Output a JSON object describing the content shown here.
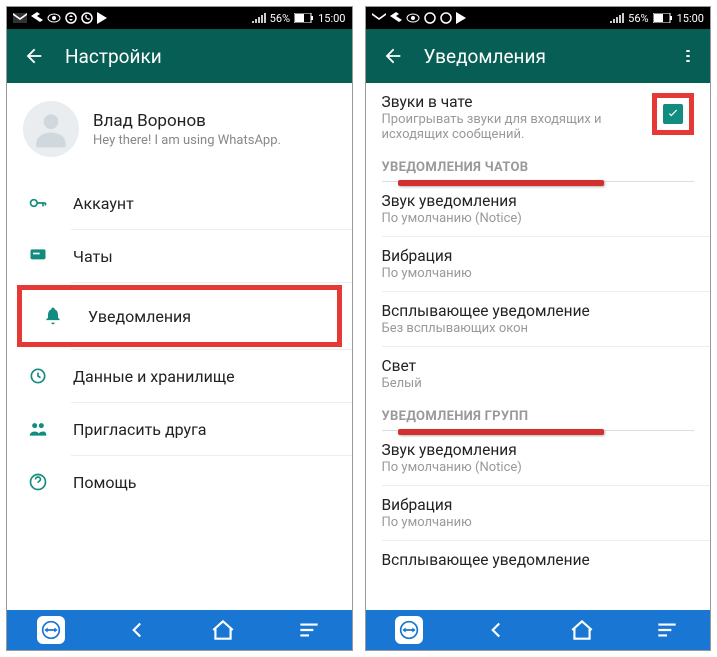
{
  "statusbar": {
    "battery": "56%",
    "time": "15:00"
  },
  "left": {
    "appbar": {
      "title": "Настройки"
    },
    "profile": {
      "name": "Влад Воронов",
      "status": "Hey there! I am using WhatsApp."
    },
    "items": {
      "account": "Аккаунт",
      "chats": "Чаты",
      "notifications": "Уведомления",
      "data": "Данные и хранилище",
      "invite": "Пригласить друга",
      "help": "Помощь"
    }
  },
  "right": {
    "appbar": {
      "title": "Уведомления"
    },
    "chatSounds": {
      "title": "Звуки в чате",
      "sub": "Проигрывать звуки для входящих и исходящих сообщений."
    },
    "sections": {
      "chats": "УВЕДОМЛЕНИЯ ЧАТОВ",
      "groups": "УВЕДОМЛЕНИЯ ГРУПП"
    },
    "sound": {
      "title": "Звук уведомления",
      "sub": "По умолчанию (Notice)"
    },
    "vibration": {
      "title": "Вибрация",
      "sub": "По умолчанию"
    },
    "popup": {
      "title": "Всплывающее уведомление",
      "sub": "Без всплывающих окон"
    },
    "light": {
      "title": "Свет",
      "sub": "Белый"
    },
    "gSound": {
      "title": "Звук уведомления",
      "sub": "По умолчанию (Notice)"
    },
    "gVibration": {
      "title": "Вибрация",
      "sub": "По умолчанию"
    },
    "gPopup": {
      "title": "Всплывающее уведомление"
    }
  }
}
